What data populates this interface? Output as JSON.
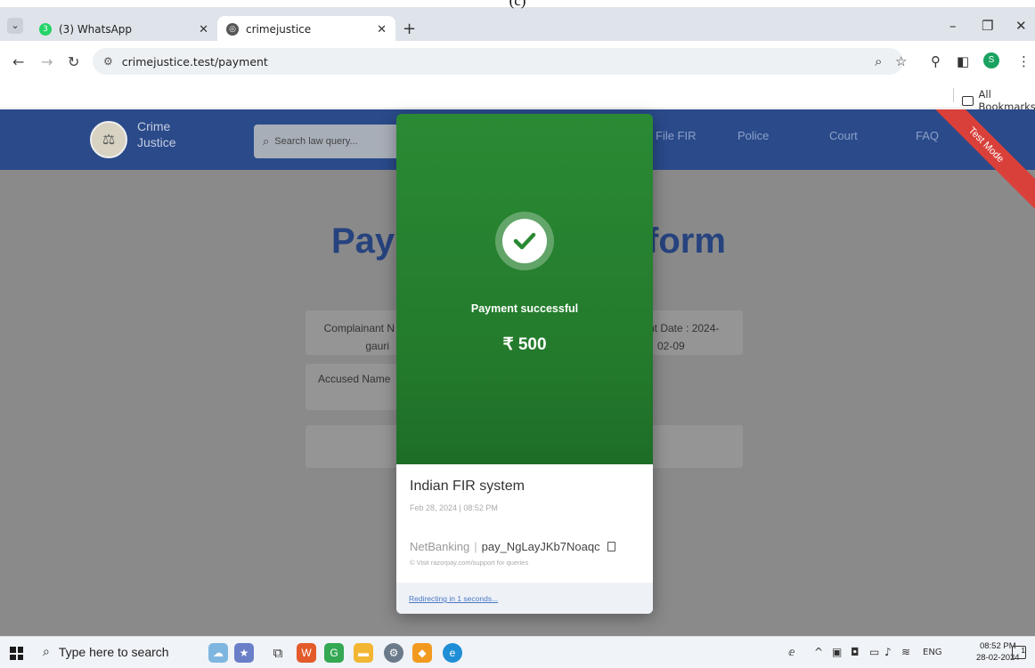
{
  "caption": "(c)",
  "browser": {
    "tabs": [
      {
        "title": "(3) WhatsApp",
        "favicon": "whatsapp-icon",
        "color": "#25d366"
      },
      {
        "title": "crimejustice",
        "favicon": "globe-icon",
        "color": "#444444"
      }
    ],
    "new_tab": "+",
    "url": "crimejustice.test/payment",
    "profile_initial": "S",
    "bookmarks_label": "All Bookmarks"
  },
  "site": {
    "brand_line1": "Crime",
    "brand_line2": "Justice",
    "search_placeholder": "Search law query...",
    "nav": [
      "File FIR",
      "Police",
      "Court",
      "FAQ"
    ],
    "ribbon": "Test Mode",
    "title_left": "Payr",
    "title_right": "form",
    "fields": {
      "complainant_left": "Complainant N",
      "complainant_value": "gauri",
      "date_right": "nt Date : 2024-",
      "date_value": "02-09",
      "accused_left": "Accused Name"
    },
    "nav_color": "#2a4a8a"
  },
  "payment": {
    "status": "Payment successful",
    "amount": "₹ 500",
    "merchant": "Indian FIR system",
    "datetime": "Feb 28, 2024 | 08:52 PM",
    "method": "NetBanking",
    "payment_id": "pay_NgLayJKb7Noaqc",
    "support": "© Visit razorpay.com/support for queries",
    "redirect": "Redirecting in 1 seconds...",
    "success_color": "#2a8a34"
  },
  "taskbar": {
    "search": "Type here to search",
    "lang": "ENG",
    "time": "08:52 PM",
    "date": "28-02-2024"
  }
}
